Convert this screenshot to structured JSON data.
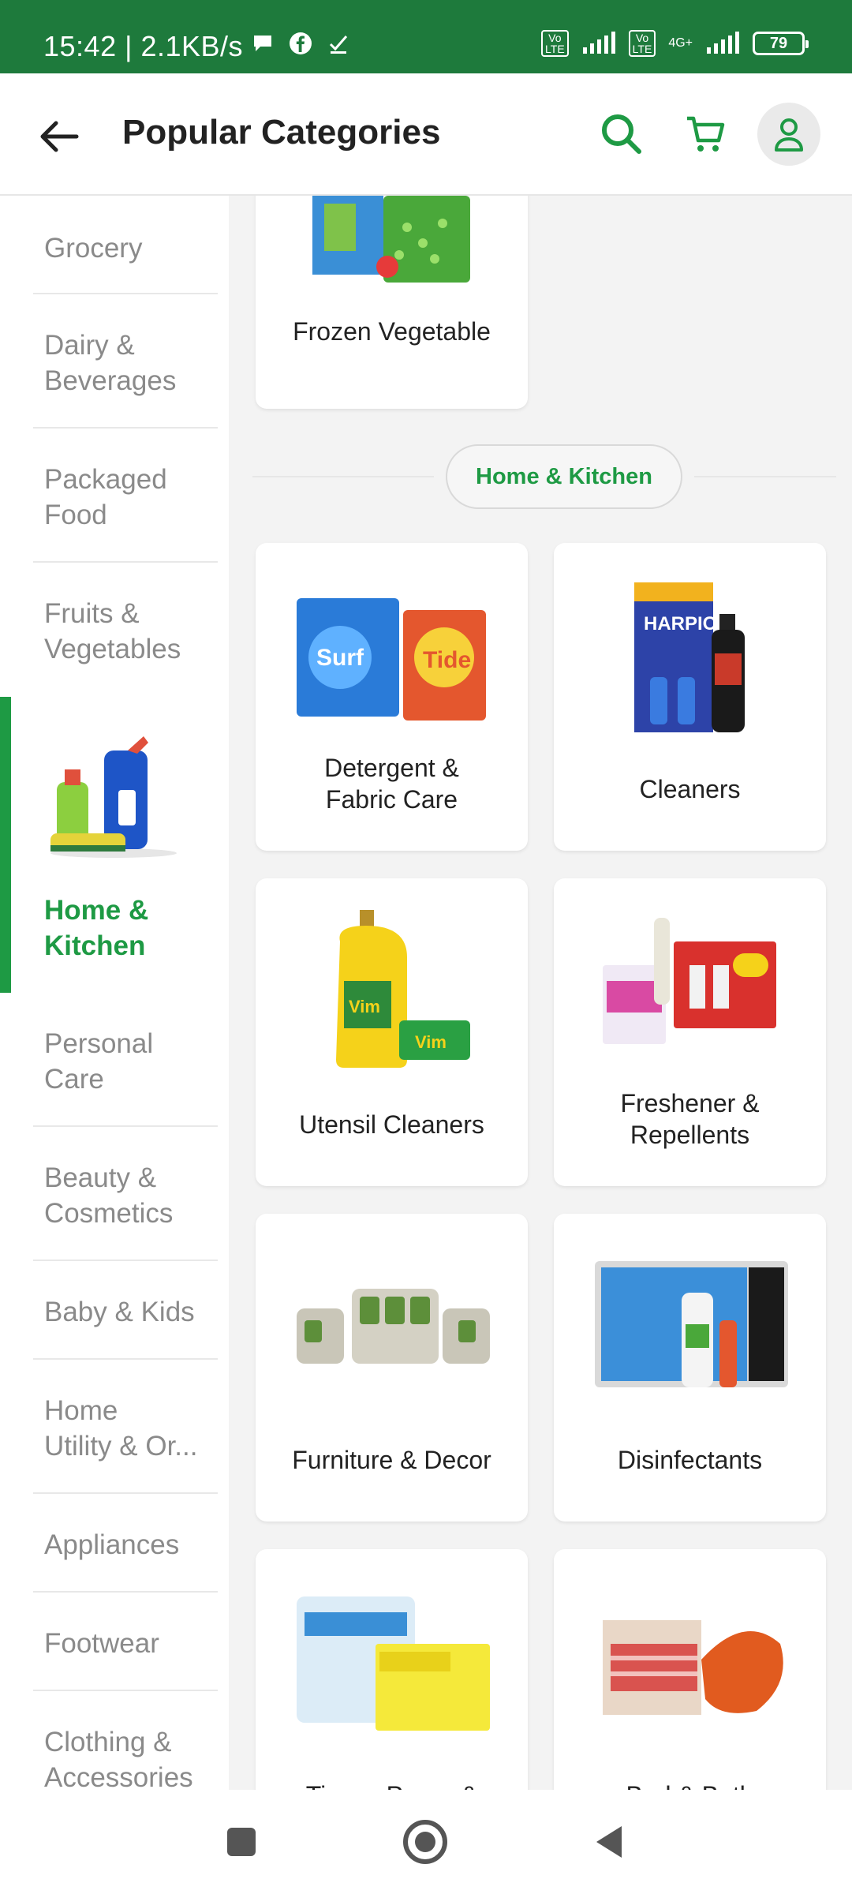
{
  "status_bar": {
    "time_speed": "15:42 | 2.1KB/s",
    "lte1": "Vo\nLTE",
    "lte2": "Vo\nLTE",
    "net": "4G+",
    "battery": "79"
  },
  "header": {
    "title": "Popular Categories"
  },
  "sidebar": {
    "items": [
      {
        "label": "Grocery"
      },
      {
        "label": "Dairy &\nBeverages"
      },
      {
        "label": "Packaged\nFood"
      },
      {
        "label": "Fruits &\nVegetables"
      },
      {
        "label": "Home &\nKitchen"
      },
      {
        "label": "Personal\nCare"
      },
      {
        "label": "Beauty &\nCosmetics"
      },
      {
        "label": "Baby & Kids"
      },
      {
        "label": "Home\nUtility & Or..."
      },
      {
        "label": "Appliances"
      },
      {
        "label": "Footwear"
      },
      {
        "label": "Clothing &\nAccessories"
      }
    ]
  },
  "main": {
    "previous_section_cards": [
      {
        "name": "Frozen Vegetable"
      }
    ],
    "section_title": "Home & Kitchen",
    "cards": [
      {
        "name": "Detergent &\nFabric Care"
      },
      {
        "name": "Cleaners"
      },
      {
        "name": "Utensil Cleaners"
      },
      {
        "name": "Freshener &\nRepellents"
      },
      {
        "name": "Furniture & Decor"
      },
      {
        "name": "Disinfectants"
      },
      {
        "name": "Tissue Paper &"
      },
      {
        "name": "Bed & Bath"
      }
    ]
  },
  "colors": {
    "brand_green": "#1e7a3c",
    "accent_green": "#1e9a44"
  }
}
